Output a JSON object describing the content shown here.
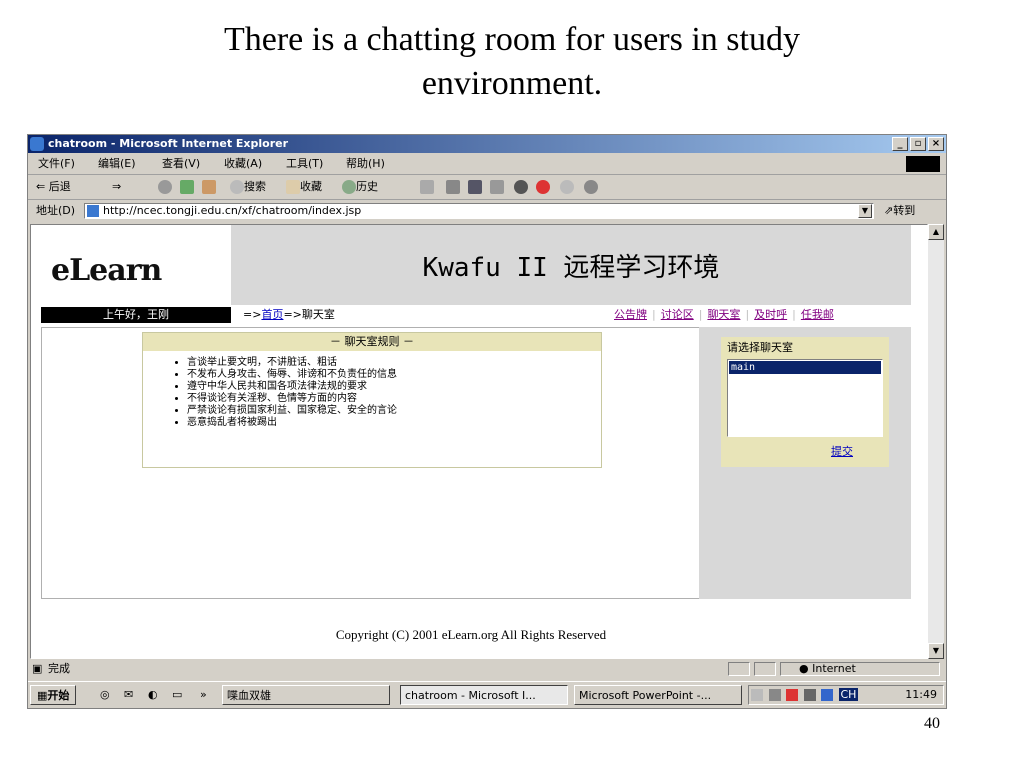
{
  "slide": {
    "title_line1": "There is a chatting room for users in study",
    "title_line2": "environment.",
    "page_number": "40"
  },
  "window": {
    "title": "chatroom - Microsoft Internet Explorer",
    "controls": [
      "_",
      "̸",
      "x"
    ]
  },
  "menu": [
    "文件(F)",
    "编辑(E)",
    "查看(V)",
    "收藏(A)",
    "工具(T)",
    "帮助(H)"
  ],
  "toolbar": {
    "back": "⇐ 后退",
    "forward": "⇒",
    "search": "搜索",
    "favorites": "收藏",
    "history": "历史"
  },
  "address": {
    "label": "地址(D)",
    "url": "http://ncec.tongji.edu.cn/xf/chatroom/index.jsp",
    "go": "转到"
  },
  "page": {
    "brand": "eLearn",
    "banner": "Kwafu II 远程学习环境",
    "greeting": "上午好，王刚",
    "breadcrumb_prefix": "=>",
    "breadcrumb_home": "首页",
    "breadcrumb_current": "=>聊天室",
    "nav": [
      "公告牌",
      "讨论区",
      "聊天室",
      "及时呼",
      "任我邮"
    ],
    "rules_title": "－ 聊天室规则 －",
    "rules": [
      "言谈举止要文明，不讲脏话、粗话",
      "不发布人身攻击、侮辱、诽谤和不负责任的信息",
      "遵守中华人民共和国各项法律法规的要求",
      "不得谈论有关淫秽、色情等方面的内容",
      "严禁谈论有损国家利益、国家稳定、安全的言论",
      "恶意捣乱者将被踢出"
    ],
    "room_select_label": "请选择聊天室",
    "room_selected": "main",
    "submit": "提交",
    "copyright": "Copyright (C) 2001 eLearn.org All Rights Reserved"
  },
  "status": {
    "left": "完成",
    "zone": "Internet"
  },
  "taskbar": {
    "start": "开始",
    "chevron": "»",
    "tasks": [
      "喋血双雄",
      "chatroom - Microsoft I...",
      "Microsoft PowerPoint -..."
    ],
    "tray_lang": "CH",
    "clock": "11:49"
  }
}
